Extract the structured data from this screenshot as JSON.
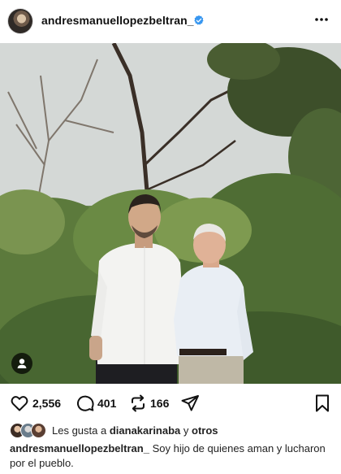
{
  "header": {
    "username": "andresmanuellopezbeltran_",
    "verified_icon": "verified-badge-icon",
    "more_icon": "more-options-icon"
  },
  "photo": {
    "description_icon": "tag-people-icon"
  },
  "actions": {
    "likes_count": "2,556",
    "comments_count": "401",
    "reposts_count": "166"
  },
  "likes_summary": {
    "prefix": "Les gusta a",
    "user": "dianakarinaba",
    "connector": "y",
    "others": "otros"
  },
  "caption": {
    "username": "andresmanuellopezbeltran_",
    "text": "Soy hijo de quienes aman y lucharon por el pueblo."
  },
  "colors": {
    "verified": "#3897f0",
    "text": "#111111"
  }
}
